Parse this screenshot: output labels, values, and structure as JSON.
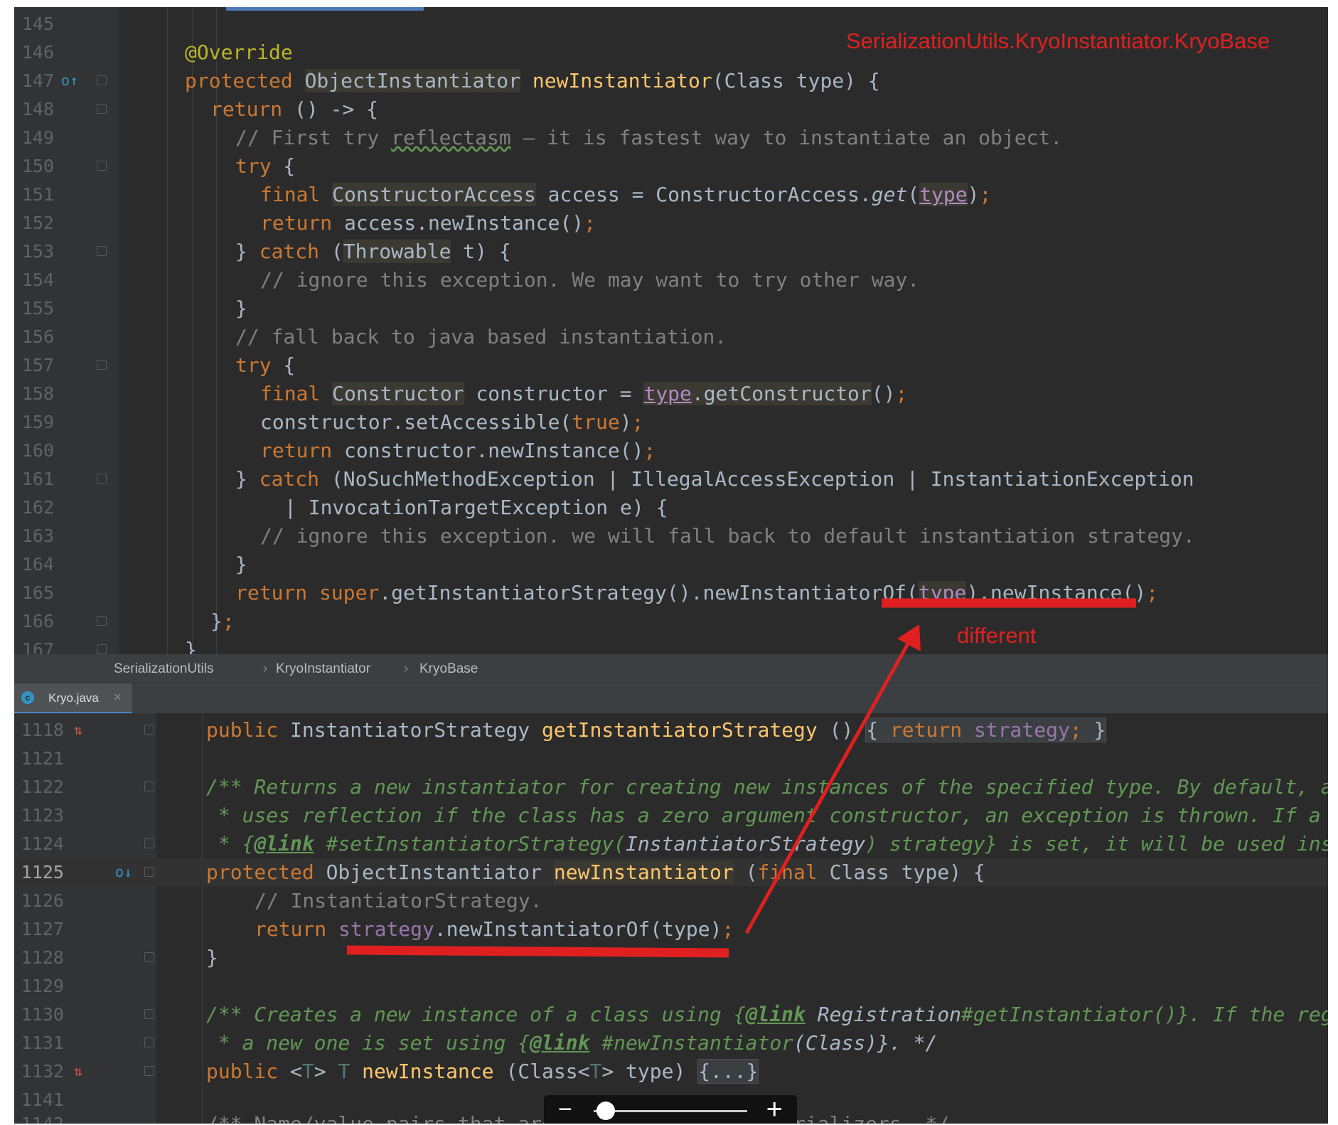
{
  "annotations": {
    "title": "SerializationUtils.KryoInstantiator.KryoBase",
    "different": "different"
  },
  "breadcrumb": [
    "SerializationUtils",
    "›",
    "KryoInstantiator",
    "›",
    "KryoBase"
  ],
  "tab": {
    "label": "Kryo.java",
    "close": "×",
    "icon": "class-c-icon"
  },
  "zoom": {
    "minus": "−",
    "plus": "+",
    "level": 0.08
  },
  "top_lines": {
    "145": "145",
    "146": "146",
    "147": "147",
    "148": "148",
    "149": "149",
    "150": "150",
    "151": "151",
    "152": "152",
    "153": "153",
    "154": "154",
    "155": "155",
    "156": "156",
    "157": "157",
    "158": "158",
    "159": "159",
    "160": "160",
    "161": "161",
    "162": "162",
    "163": "163",
    "164": "164",
    "165": "165",
    "166": "166",
    "167": "167"
  },
  "bottom_lines": {
    "1118": "1118",
    "1121": "1121",
    "1122": "1122",
    "1123": "1123",
    "1124": "1124",
    "1125": "1125",
    "1126": "1126",
    "1127": "1127",
    "1128": "1128",
    "1129": "1129",
    "1130": "1130",
    "1131": "1131",
    "1132": "1132",
    "1141": "1141",
    "1142": "1142"
  },
  "tokens": {
    "override": "@Override",
    "protected": "protected",
    "ObjectInstantiator": "ObjectInstantiator",
    "newInstantiator": "newInstantiator",
    "classType": "(Class type) {",
    "return": "return",
    "lambda": " () -> {",
    "c149a": "// First try ",
    "c149b": "reflectasm",
    "c149c": " – it is fastest way to instantiate an object.",
    "try": "try",
    "brace": " {",
    "final": "final",
    "ConstructorAccess": "ConstructorAccess",
    "l151a": " access = ConstructorAccess.",
    "get": "get",
    "lparen": "(",
    "type": "type",
    "rparen": ")",
    "semi": ";",
    "l152": " access.newInstance()",
    "closeBrace": "} ",
    "catch": "catch",
    "l153a": " (",
    "Throwable": "Throwable",
    "l153b": " t) {",
    "c154": "// ignore this exception. We may want to try other way.",
    "rbrace": "}",
    "c156": "// fall back to java based instantiation.",
    "Constructor": "Constructor",
    "l158a": " constructor = ",
    "getConstructor": ".getConstructor",
    "parens": "()",
    "l159a": "constructor.setAccessible(",
    "true": "true",
    "l160": " constructor.newInstance()",
    "l161": " (NoSuchMethodException | IllegalAccessException | InstantiationException",
    "l162": "| InvocationTargetException e) {",
    "c163": "// ignore this exception. we will fall back to default instantiation strategy.",
    "super": "super",
    "l165a": ".getInstantiatorStrategy().newInstantiatorOf(",
    "l165b": ").newInstance()",
    "l166": "}",
    "public": "public",
    "InstantiatorStrategy": " InstantiatorStrategy ",
    "getInstantiatorStrategy": "getInstantiatorStrategy",
    "l1118a": " () ",
    "foldOpen": "{ ",
    "strategy": "strategy",
    "foldClose": " }",
    "d1122": "/** Returns a new instantiator for creating new instances of the specified type. By default, an instantiator is returned that",
    "d1123": " * uses reflection if the class has a zero argument constructor, an exception is thrown. If a",
    "d1124a": " * {",
    "link": "@link",
    "d1124b": " #setInstantiatorStrategy(",
    "d1124c": "InstantiatorStrategy",
    "d1124d": ") strategy} is set, it will be used instead of throwing an exception. */",
    "ObjectInstantiatorSp": " ObjectInstantiator ",
    "l1125a": " (",
    "l1125b": " Class type) {",
    "c1126": "// InstantiatorStrategy.",
    "l1127a": ".newInstantiatorOf(type)",
    "d1130a": "/** Creates a new instance of a class using {",
    "d1130b": " Registration",
    "d1130c": "#getInstantiator()}. If the registration's instantiator is null,",
    "d1131a": " * a new one is set using {",
    "d1131b": " #newInstantiator",
    "d1131c": "(Class)}. */",
    "lt": " <",
    "T": "T",
    "gt": ">",
    "Tsp": " T ",
    "newInstance": "newInstance",
    "l1132a": " (Class<",
    "l1132b": "> type) ",
    "dots": "{...}",
    "d1142": "/** Name/value pairs that are available to all serializers. */"
  },
  "colors": {
    "arrow": "#e02020",
    "editor_bg": "#2b2b2b",
    "keyword": "#cc7832",
    "method": "#ffc66d",
    "comment": "#808080",
    "doc": "#629755"
  }
}
